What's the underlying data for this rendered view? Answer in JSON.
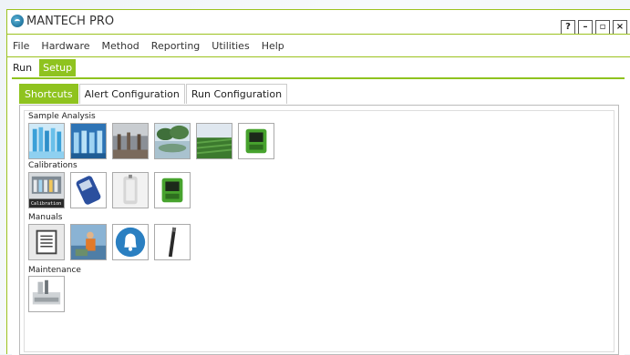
{
  "window": {
    "title": "MANTECH PRO",
    "controls": [
      "?",
      "–",
      "▫",
      "×"
    ]
  },
  "menu": [
    "File",
    "Hardware",
    "Method",
    "Reporting",
    "Utilities",
    "Help"
  ],
  "modes": [
    {
      "label": "Run",
      "active": false
    },
    {
      "label": "Setup",
      "active": true
    }
  ],
  "tabs": [
    {
      "label": "Shortcuts",
      "active": true
    },
    {
      "label": "Alert Configuration",
      "active": false
    },
    {
      "label": "Run Configuration",
      "active": false
    }
  ],
  "sections": [
    {
      "label": "Sample Analysis",
      "items": [
        "test-tubes-icon",
        "sample-bottles-icon",
        "treatment-plant-icon",
        "mangrove-water-icon",
        "crop-field-icon",
        "meter-device-icon"
      ]
    },
    {
      "label": "Calibrations",
      "items": [
        "calibration-rack-icon",
        "handheld-meter-icon",
        "bottle-sampler-icon",
        "meter-device-icon"
      ]
    },
    {
      "label": "Manuals",
      "items": [
        "document-icon",
        "field-technician-icon",
        "bell-icon",
        "probe-icon"
      ]
    },
    {
      "label": "Maintenance",
      "items": [
        "autosampler-icon"
      ]
    }
  ],
  "calibration_caption": "Calibration",
  "colors": {
    "accent": "#8fc31f",
    "bell": "#2a7fc1"
  }
}
